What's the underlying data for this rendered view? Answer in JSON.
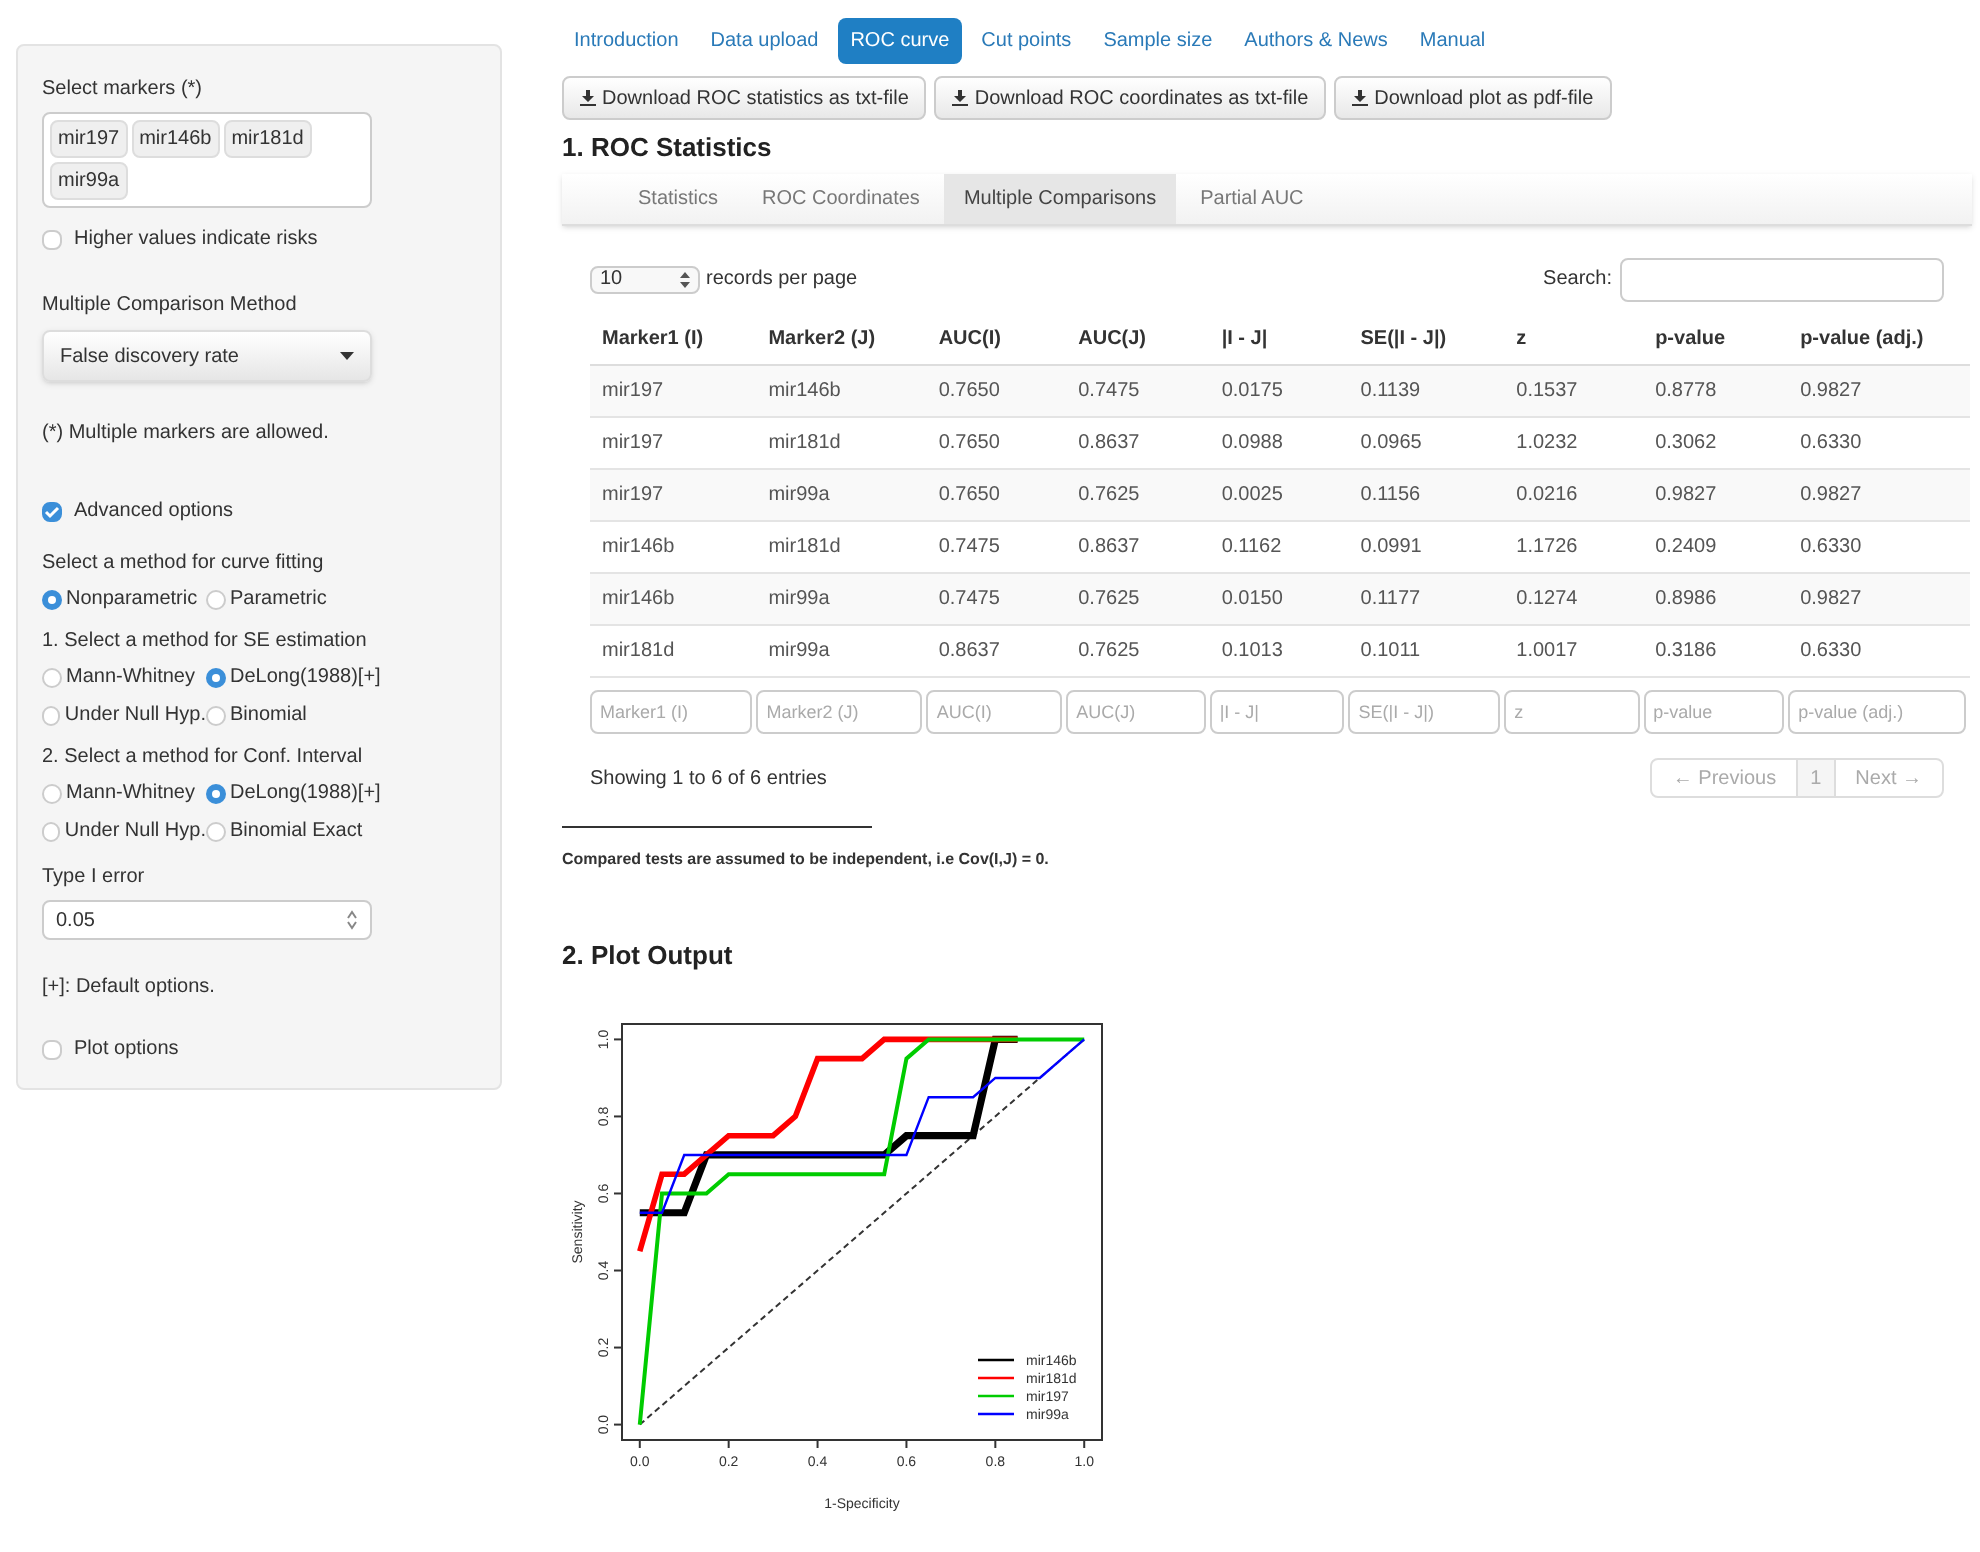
{
  "sidebar": {
    "markers_label": "Select markers (*)",
    "markers": [
      "mir197",
      "mir146b",
      "mir181d",
      "mir99a"
    ],
    "higher_values": {
      "label": "Higher values indicate risks",
      "checked": false
    },
    "method_label": "Multiple Comparison Method",
    "method_value": "False discovery rate",
    "note": "(*) Multiple markers are allowed.",
    "advanced": {
      "label": "Advanced options",
      "checked": true
    },
    "radio_groups": [
      {
        "label": "Select a method for curve fitting",
        "options": [
          {
            "label": "Nonparametric",
            "selected": true
          },
          {
            "label": "Parametric",
            "selected": false
          }
        ]
      },
      {
        "label": "1. Select a method for SE estimation",
        "options": [
          {
            "label": "Mann-Whitney",
            "selected": false
          },
          {
            "label": "DeLong(1988)[+]",
            "selected": true
          },
          {
            "label": "Under Null Hyp.",
            "selected": false
          },
          {
            "label": "Binomial",
            "selected": false
          }
        ]
      },
      {
        "label": "2. Select a method for Conf. Interval",
        "options": [
          {
            "label": "Mann-Whitney",
            "selected": false
          },
          {
            "label": "DeLong(1988)[+]",
            "selected": true
          },
          {
            "label": "Under Null Hyp.",
            "selected": false
          },
          {
            "label": "Binomial Exact",
            "selected": false
          }
        ]
      }
    ],
    "type_error_label": "Type I error",
    "type_error_value": "0.05",
    "default_note": "[+]: Default options.",
    "plot_options": {
      "label": "Plot options",
      "checked": false
    }
  },
  "nav_tabs": [
    {
      "label": "Introduction",
      "selected": false
    },
    {
      "label": "Data upload",
      "selected": false
    },
    {
      "label": "ROC curve",
      "selected": true
    },
    {
      "label": "Cut points",
      "selected": false
    },
    {
      "label": "Sample size",
      "selected": false
    },
    {
      "label": "Authors & News",
      "selected": false
    },
    {
      "label": "Manual",
      "selected": false
    }
  ],
  "download_buttons": [
    "Download ROC statistics as txt-file",
    "Download ROC coordinates as txt-file",
    "Download plot as pdf-file"
  ],
  "section_1_title": "1. ROC Statistics",
  "sub_tabs": [
    {
      "label": "Statistics",
      "selected": false
    },
    {
      "label": "ROC Coordinates",
      "selected": false
    },
    {
      "label": "Multiple Comparisons",
      "selected": true
    },
    {
      "label": "Partial AUC",
      "selected": false
    }
  ],
  "page_length": "10",
  "page_length_label": "records per page",
  "search_label": "Search:",
  "table": {
    "columns": [
      "Marker1 (I)",
      "Marker2 (J)",
      "AUC(I)",
      "AUC(J)",
      "|I - J|",
      "SE(|I - J|)",
      "z",
      "p-value",
      "p-value (adj.)"
    ],
    "rows": [
      [
        "mir197",
        "mir146b",
        "0.7650",
        "0.7475",
        "0.0175",
        "0.1139",
        "0.1537",
        "0.8778",
        "0.9827"
      ],
      [
        "mir197",
        "mir181d",
        "0.7650",
        "0.8637",
        "0.0988",
        "0.0965",
        "1.0232",
        "0.3062",
        "0.6330"
      ],
      [
        "mir197",
        "mir99a",
        "0.7650",
        "0.7625",
        "0.0025",
        "0.1156",
        "0.0216",
        "0.9827",
        "0.9827"
      ],
      [
        "mir146b",
        "mir181d",
        "0.7475",
        "0.8637",
        "0.1162",
        "0.0991",
        "1.1726",
        "0.2409",
        "0.6330"
      ],
      [
        "mir146b",
        "mir99a",
        "0.7475",
        "0.7625",
        "0.0150",
        "0.1177",
        "0.1274",
        "0.8986",
        "0.9827"
      ],
      [
        "mir181d",
        "mir99a",
        "0.8637",
        "0.7625",
        "0.1013",
        "0.1011",
        "1.0017",
        "0.3186",
        "0.6330"
      ]
    ],
    "filter_placeholders": [
      "Marker1 (I)",
      "Marker2 (J)",
      "AUC(I)",
      "AUC(J)",
      "|I - J|",
      "SE(|I - J|)",
      "z",
      "p-value",
      "p-value (adj.)"
    ]
  },
  "info": "Showing 1 to 6 of 6 entries",
  "pagination": {
    "previous": "← Previous",
    "page": "1",
    "next": "Next →"
  },
  "footnote": "Compared tests are assumed to be independent, i.e Cov(I,J) = 0.",
  "section_2_title": "2. Plot Output",
  "plot": {
    "chart_data": {
      "type": "line",
      "xlabel": "1-Specificity",
      "ylabel": "Sensitivity",
      "x": [
        0,
        0.05,
        0.1,
        0.15,
        0.2,
        0.25,
        0.3,
        0.35,
        0.4,
        0.45,
        0.5,
        0.55,
        0.6,
        0.65,
        0.7,
        0.75,
        0.8,
        0.85,
        0.9,
        0.95,
        1
      ],
      "series": [
        {
          "name": "mir146b",
          "color": "#000000",
          "values": [
            0.55,
            0.55,
            0.55,
            0.7,
            0.7,
            0.7,
            0.7,
            0.7,
            0.7,
            0.7,
            0.7,
            0.7,
            0.75,
            0.75,
            0.75,
            0.75,
            1,
            1,
            null,
            null,
            null
          ]
        },
        {
          "name": "mir181d",
          "color": "#ff0000",
          "values": [
            0.45,
            0.65,
            0.65,
            0.7,
            0.75,
            0.75,
            0.75,
            0.8,
            0.95,
            0.95,
            0.95,
            1,
            1,
            1,
            1,
            1,
            1,
            1,
            null,
            null,
            null
          ]
        },
        {
          "name": "mir197",
          "color": "#00cc00",
          "values": [
            0,
            0.6,
            0.6,
            0.6,
            0.65,
            0.65,
            0.65,
            0.65,
            0.65,
            0.65,
            0.65,
            0.65,
            0.95,
            1,
            1,
            1,
            1,
            1,
            1,
            1,
            1
          ]
        },
        {
          "name": "mir99a",
          "color": "#0000ff",
          "values": [
            0.55,
            0.55,
            0.7,
            0.7,
            0.7,
            0.7,
            0.7,
            0.7,
            0.7,
            0.7,
            0.7,
            0.7,
            0.7,
            0.85,
            0.85,
            0.85,
            0.9,
            0.9,
            0.9,
            0.95,
            1
          ]
        }
      ],
      "xlim": [
        -0.04,
        1.04
      ],
      "ylim": [
        -0.04,
        1.04
      ],
      "legend": "bottom-right",
      "xticks": [
        {
          "value": 0,
          "label": "0.0"
        },
        {
          "value": 0.2,
          "label": "0.2"
        },
        {
          "value": 0.4,
          "label": "0.4"
        },
        {
          "value": 0.6,
          "label": "0.6"
        },
        {
          "value": 0.8,
          "label": "0.8"
        },
        {
          "value": 1,
          "label": "1.0"
        }
      ],
      "yticks": [
        {
          "value": 0,
          "label": "0.0"
        },
        {
          "value": 0.2,
          "label": "0.2"
        },
        {
          "value": 0.4,
          "label": "0.4"
        },
        {
          "value": 0.6,
          "label": "0.6"
        },
        {
          "value": 0.8,
          "label": "0.8"
        },
        {
          "value": 1,
          "label": "1.0"
        }
      ]
    }
  }
}
